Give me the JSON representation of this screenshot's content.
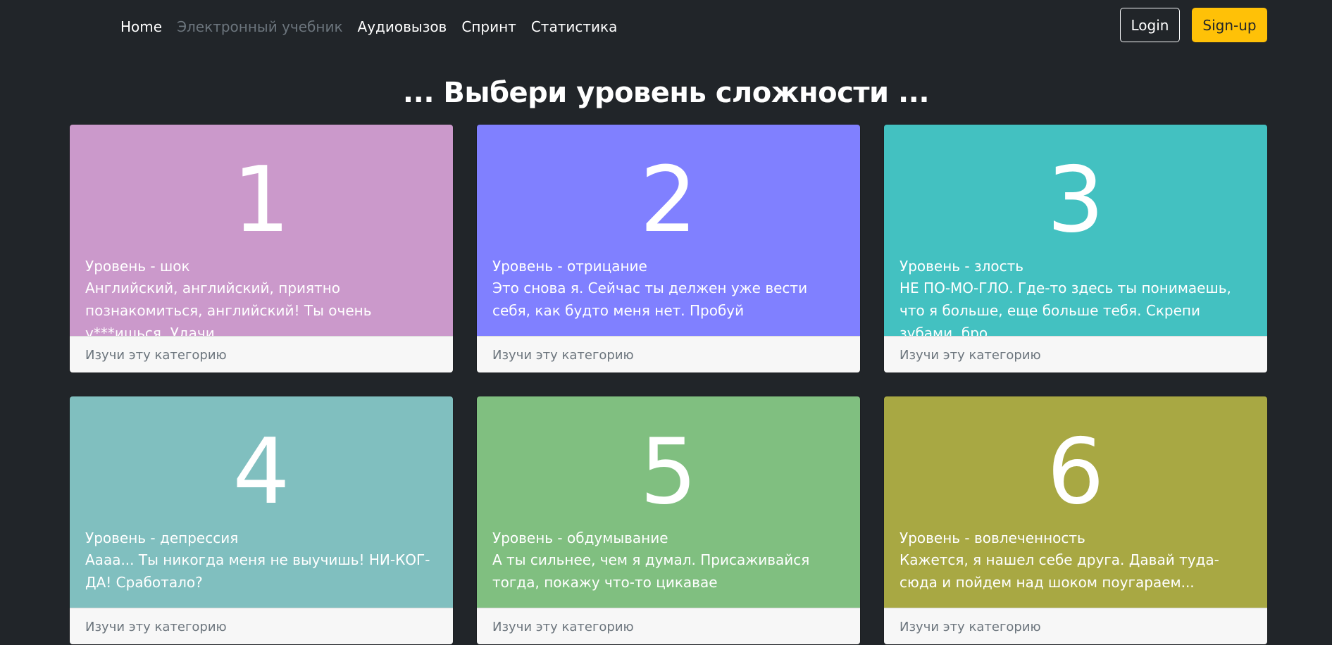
{
  "nav": {
    "links": [
      {
        "label": "Home",
        "active": true
      },
      {
        "label": "Электронный учебник",
        "disabled": true
      },
      {
        "label": "Аудиовызов"
      },
      {
        "label": "Спринт"
      },
      {
        "label": "Статистика"
      }
    ],
    "login_label": "Login",
    "signup_label": "Sign-up"
  },
  "page_title": "... Выбери уровень сложности ...",
  "colors": {
    "background": "#212529",
    "signup": "#ffc107"
  },
  "levels": [
    {
      "number": "1",
      "title": "Уровень - шок",
      "text": "Английский, английский, приятно познакомиться, английский! Ты очень у***ишься. Удачи",
      "link": "Изучи эту категорию",
      "color": "#cb99cb"
    },
    {
      "number": "2",
      "title": "Уровень - отрицание",
      "text": "Это снова я. Сейчас ты делжен уже вести себя, как будто меня нет. Пробуй",
      "link": "Изучи эту категорию",
      "color": "#8080ff"
    },
    {
      "number": "3",
      "title": "Уровень - злость",
      "text": "НЕ ПО-МО-ГЛО. Где-то здесь ты понимаешь, что я больше, еще больше тебя. Скрепи зубами, бро",
      "link": "Изучи эту категорию",
      "color": "#43c1c1"
    },
    {
      "number": "4",
      "title": "Уровень - депрессия",
      "text": "Аааа... Ты никогда меня не выучишь! НИ-КОГ-ДА! Сработало?",
      "link": "Изучи эту категорию",
      "color": "#80bfbf"
    },
    {
      "number": "5",
      "title": "Уровень - обдумывание",
      "text": "А ты сильнее, чем я думал. Присаживайся тогда, покажу что-то цикавае",
      "link": "Изучи эту категорию",
      "color": "#80bf80"
    },
    {
      "number": "6",
      "title": "Уровень - вовлеченность",
      "text": "Кажется, я нашел себе друга. Давай туда-сюда и пойдем над шоком поугараем...",
      "link": "Изучи эту категорию",
      "color": "#a8a843"
    }
  ]
}
